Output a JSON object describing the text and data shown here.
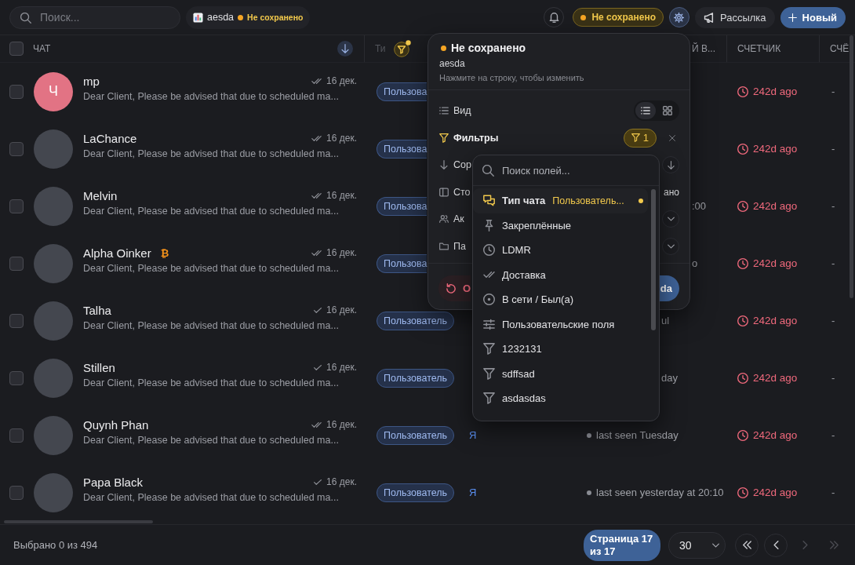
{
  "topbar": {
    "search": {
      "placeholder": "Поиск..."
    },
    "view_chip": {
      "name": "aesda",
      "status": "Не сохранено"
    },
    "actions": [
      {
        "kind": "bell",
        "active": false
      },
      {
        "kind": "unsaved",
        "label": "Не сохранено"
      },
      {
        "kind": "settings",
        "active": true
      },
      {
        "kind": "broadcast",
        "label": "Рассылка"
      },
      {
        "kind": "new",
        "label": "Новый"
      }
    ]
  },
  "table": {
    "select_all": {
      "checked": false
    },
    "columns": [
      {
        "kind": "chat",
        "label": "ЧАТ",
        "filtered": false
      },
      {
        "kind": "type",
        "label": "Ти",
        "filtered": true
      },
      {
        "kind": "status",
        "label": "Й В...",
        "filtered": false
      },
      {
        "kind": "counter",
        "label": "СЧЕТЧИК",
        "filtered": false
      },
      {
        "kind": "extra",
        "label": "СЧЁ",
        "filtered": false
      }
    ],
    "rows": [
      {
        "selected": false,
        "avatar": {
          "kind": "letter",
          "text": "Ч"
        },
        "name": "mp",
        "read": true,
        "date": "16 дек.",
        "message": "Dear Client, Please be advised that due to scheduled ma...",
        "type": "Пользова",
        "counter": "242d ago",
        "extra": "-"
      },
      {
        "selected": false,
        "avatar": {
          "kind": "photo"
        },
        "name": "LaChance",
        "read": true,
        "date": "16 дек.",
        "message": "Dear Client, Please be advised that due to scheduled ma...",
        "type": "Пользова",
        "counter": "242d ago",
        "extra": "-"
      },
      {
        "selected": false,
        "avatar": {
          "kind": "photo"
        },
        "name": "Melvin",
        "read": true,
        "date": "16 дек.",
        "message": "Dear Client, Please be advised that due to scheduled ma...",
        "type": "Пользова",
        "status": ":00",
        "counter": "242d ago",
        "extra": "-"
      },
      {
        "selected": false,
        "avatar": {
          "kind": "photo"
        },
        "name": "Alpha Oinker",
        "badge": "₿",
        "read": true,
        "date": "16 дек.",
        "message": "Dear Client, Please be advised that due to scheduled ma...",
        "type": "Пользова",
        "status": "o",
        "counter": "242d ago",
        "extra": "-"
      },
      {
        "selected": false,
        "avatar": {
          "kind": "photo"
        },
        "name": "Talha",
        "read": false,
        "date": "16 дек.",
        "message": "Dear Client, Please be advised that due to scheduled ma...",
        "type": "Пользователь",
        "status": "ul",
        "counter": "242d ago",
        "extra": "-"
      },
      {
        "selected": false,
        "avatar": {
          "kind": "photo"
        },
        "name": "Stillen",
        "read": false,
        "date": "16 дек.",
        "message": "Dear Client, Please be advised that due to scheduled ma...",
        "type": "Пользователь",
        "status": "day",
        "counter": "242d ago",
        "extra": "-"
      },
      {
        "selected": false,
        "avatar": {
          "kind": "photo"
        },
        "name": "Quynh Phan",
        "read": true,
        "date": "16 дек.",
        "message": "Dear Client, Please be advised that due to scheduled ma...",
        "type": "Пользователь",
        "assignee": "Я",
        "presence": {
          "online": false,
          "text": "last seen Tuesday"
        },
        "counter": "242d ago",
        "extra": "-"
      },
      {
        "selected": false,
        "avatar": {
          "kind": "photo"
        },
        "name": "Papa Black",
        "read": false,
        "date": "16 дек.",
        "message": "Dear Client, Please be advised that due to scheduled ma...",
        "type": "Пользователь",
        "assignee": "Я",
        "presence": {
          "online": false,
          "text": "last seen yesterday at 20:10"
        },
        "counter": "242d ago",
        "extra": "-"
      }
    ]
  },
  "footer": {
    "selection": "Выбрано 0 из 494",
    "page_label": "Страница 17 из 17",
    "page_size": "30",
    "pager": [
      {
        "kind": "first",
        "disabled": false
      },
      {
        "kind": "prev",
        "disabled": false
      },
      {
        "kind": "next",
        "disabled": true
      },
      {
        "kind": "last",
        "disabled": true
      }
    ]
  },
  "view_menu": {
    "status": "Не сохранено",
    "name": "aesda",
    "hint": "Нажмите на строку, чтобы изменить",
    "rows": [
      {
        "kind": "view",
        "label": "Вид",
        "options": [
          {
            "kind": "list",
            "selected": true
          },
          {
            "kind": "grid",
            "selected": false
          }
        ]
      },
      {
        "kind": "filters",
        "label": "Фильтры",
        "count": "1",
        "active": true
      },
      {
        "kind": "sort",
        "label": "Сор"
      },
      {
        "kind": "columns",
        "label": "Сто",
        "value": "ано"
      },
      {
        "kind": "accounts",
        "label": "Ак"
      },
      {
        "kind": "folders",
        "label": "Па"
      }
    ],
    "reset_label": "О",
    "save_label": "da"
  },
  "field_picker": {
    "placeholder": "Поиск полей...",
    "fields": [
      {
        "kind": "chat_type",
        "label": "Тип чата",
        "value": "Пользователь...",
        "active": true
      },
      {
        "kind": "pinned",
        "label": "Закреплённые",
        "active": false
      },
      {
        "kind": "date",
        "label": "LDMR",
        "active": false
      },
      {
        "kind": "delivery",
        "label": "Доставка",
        "active": false
      },
      {
        "kind": "presence",
        "label": "В сети / Был(а)",
        "active": false
      },
      {
        "kind": "custom_fields",
        "label": "Пользовательские поля",
        "active": false
      },
      {
        "kind": "custom",
        "label": "1232131",
        "active": false
      },
      {
        "kind": "custom",
        "label": "sdffsad",
        "active": false
      },
      {
        "kind": "custom",
        "label": "asdasdas",
        "active": false
      }
    ]
  }
}
